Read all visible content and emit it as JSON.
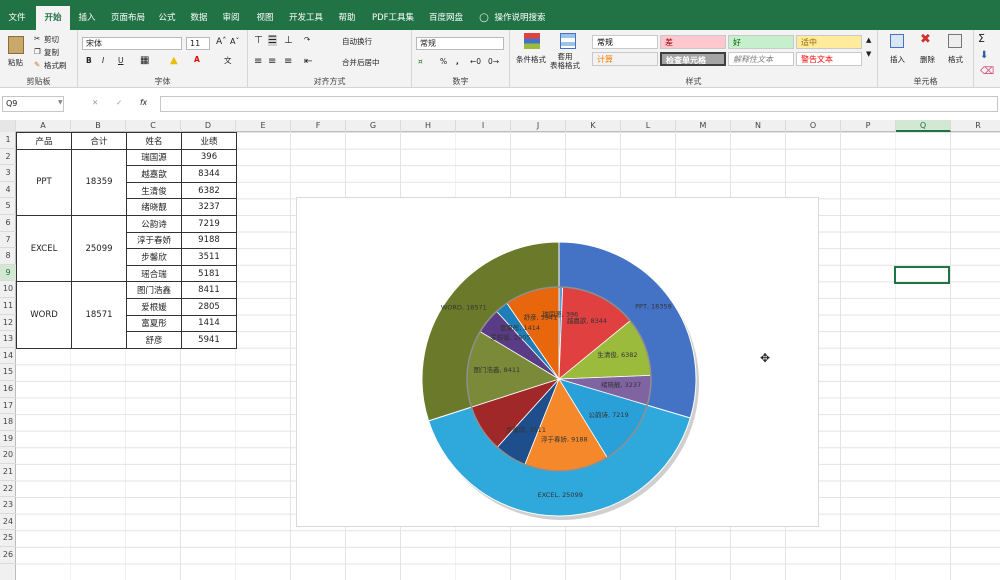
{
  "ribbon_tabs": [
    "文件",
    "开始",
    "插入",
    "页面布局",
    "公式",
    "数据",
    "审阅",
    "视图",
    "开发工具",
    "帮助",
    "PDF工具集",
    "百度网盘",
    "操作说明搜索"
  ],
  "clipboard": {
    "paste": "粘贴",
    "cut": "剪切",
    "copy": "复制",
    "format_painter": "格式刷",
    "label": "剪贴板"
  },
  "font": {
    "name": "宋体",
    "size": "11",
    "label": "字体",
    "bold": "B",
    "italic": "I",
    "underline": "U"
  },
  "alignment": {
    "wrap": "自动换行",
    "merge": "合并后居中",
    "label": "对齐方式"
  },
  "number": {
    "format": "常规",
    "percent": "%",
    "comma": ",",
    "label": "数字"
  },
  "styles": {
    "conditional": "条件格式",
    "table_format": "套用\n表格格式",
    "label": "样式",
    "items": [
      {
        "text": "常规",
        "bg": "#ffffff",
        "fg": "#000000"
      },
      {
        "text": "差",
        "bg": "#ffc7ce",
        "fg": "#9c0006"
      },
      {
        "text": "好",
        "bg": "#c6efce",
        "fg": "#006100"
      },
      {
        "text": "适中",
        "bg": "#ffeb9c",
        "fg": "#9c6500"
      },
      {
        "text": "计算",
        "bg": "#f2f2f2",
        "fg": "#fa7d00"
      },
      {
        "text": "检查单元格",
        "bg": "#a5a5a5",
        "fg": "#ffffff"
      },
      {
        "text": "解释性文本",
        "bg": "#ffffff",
        "fg": "#7f7f7f"
      },
      {
        "text": "警告文本",
        "bg": "#ffffff",
        "fg": "#ff0000"
      }
    ]
  },
  "cells_group": {
    "insert": "插入",
    "delete": "删除",
    "format": "格式",
    "label": "单元格"
  },
  "name_box": "Q9",
  "fx": "fx",
  "columns": [
    "A",
    "B",
    "C",
    "D",
    "E",
    "F",
    "G",
    "H",
    "I",
    "J",
    "K",
    "L",
    "M",
    "N",
    "O",
    "P",
    "Q",
    "R"
  ],
  "rows": [
    "1",
    "2",
    "3",
    "4",
    "5",
    "6",
    "7",
    "8",
    "9",
    "10",
    "11",
    "12",
    "13",
    "14",
    "15",
    "16",
    "17",
    "18",
    "19",
    "20",
    "21",
    "22",
    "23",
    "24",
    "25",
    "26"
  ],
  "table": {
    "headers": [
      "产品",
      "合计",
      "姓名",
      "业绩"
    ],
    "groups": [
      {
        "product": "PPT",
        "total": "18359",
        "people": [
          [
            "瑞国源",
            "396"
          ],
          [
            "越嘉歆",
            "8344"
          ],
          [
            "生清俊",
            "6382"
          ],
          [
            "绪晓靓",
            "3237"
          ]
        ]
      },
      {
        "product": "EXCEL",
        "total": "25099",
        "people": [
          [
            "公韵诗",
            "7219"
          ],
          [
            "淳于春娇",
            "9188"
          ],
          [
            "步馨欣",
            "3511"
          ],
          [
            "瑶合瑞",
            "5181"
          ]
        ]
      },
      {
        "product": "WORD",
        "total": "18571",
        "people": [
          [
            "图门浩鑫",
            "8411"
          ],
          [
            "爱根媛",
            "2805"
          ],
          [
            "富夏彤",
            "1414"
          ],
          [
            "舒彦",
            "5941"
          ]
        ]
      }
    ]
  },
  "chart_data": {
    "type": "pie",
    "title": "",
    "outer": {
      "categories": [
        "PPT",
        "EXCEL",
        "WORD"
      ],
      "values": [
        18359,
        25099,
        18571
      ],
      "colors": [
        "#4472c4",
        "#2fa8dc",
        "#6b7a2a"
      ],
      "labels": [
        "PPT, 18359",
        "EXCEL, 25099",
        "WORD, 18571"
      ]
    },
    "inner": {
      "categories": [
        "瑞国源",
        "越嘉歆",
        "生清俊",
        "绪晓靓",
        "公韵诗",
        "淳于春娇",
        "步馨欣",
        "瑶合瑞",
        "图门浩鑫",
        "爱根媛",
        "富夏彤",
        "舒彦"
      ],
      "values": [
        396,
        8344,
        6382,
        3237,
        7219,
        9188,
        3511,
        5181,
        8411,
        2805,
        1414,
        5941
      ],
      "colors": [
        "#5b9bd5",
        "#e04040",
        "#9bbb3c",
        "#8064a2",
        "#2aa0d8",
        "#f5882a",
        "#1f4e8c",
        "#a02828",
        "#7a8a38",
        "#5a3c86",
        "#1e7fb8",
        "#e8660c"
      ],
      "labels": [
        "瑞国源, 396",
        "越嘉歆, 8344",
        "生清俊, 6382",
        "绪晓靓, 3237",
        "公韵诗, 7219",
        "淳于春娇, 9188",
        "步馨欣, 3511",
        "",
        "图门浩鑫, 8411",
        "爱根媛, 2805",
        "富夏彤, 1414",
        "舒彦, 5941"
      ]
    }
  }
}
